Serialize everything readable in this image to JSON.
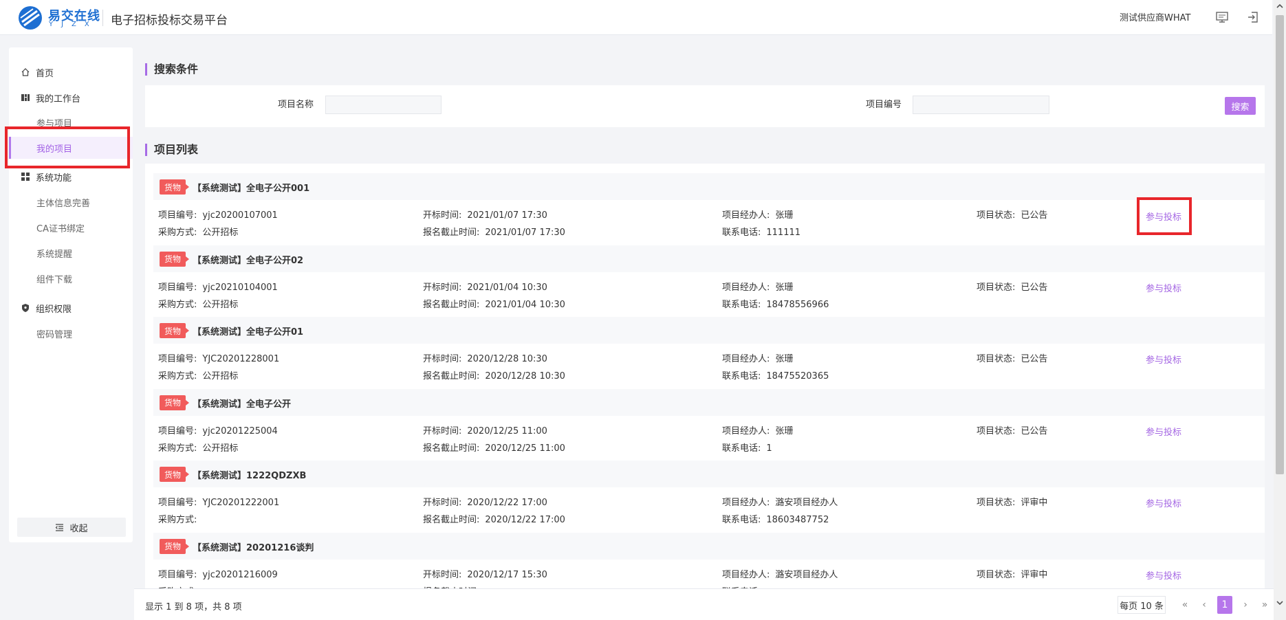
{
  "header": {
    "logo_text": "易交在线",
    "logo_sub": "YJZX",
    "title": "电子招标投标交易平台",
    "user": "测试供应商WHAT",
    "icons": [
      "monitor-icon",
      "logout-icon"
    ]
  },
  "sidebar": {
    "home": "首页",
    "workbench": "我的工作台",
    "join_project": "参与项目",
    "my_project": "我的项目",
    "system": "系统功能",
    "subject_info": "主体信息完善",
    "ca_bind": "CA证书绑定",
    "reminder": "系统提醒",
    "component_dl": "组件下载",
    "org_perm": "组织权限",
    "password": "密码管理",
    "collapse": "收起"
  },
  "search": {
    "section_title": "搜索条件",
    "name_label": "项目名称",
    "code_label": "项目编号",
    "button": "搜索"
  },
  "list": {
    "section_title": "项目列表",
    "labels": {
      "code": "项目编号:",
      "open_time": "开标时间:",
      "manager": "项目经办人:",
      "status": "项目状态:",
      "method": "采购方式:",
      "deadline": "报名截止时间:",
      "phone": "联系电话:"
    },
    "action": "参与投标",
    "items": [
      {
        "badge": "货物",
        "title": "【系统测试】全电子公开001",
        "code": "yjc20200107001",
        "open_time": "2021/01/07 17:30",
        "manager": "张珊",
        "status": "已公告",
        "method": "公开招标",
        "deadline": "2021/01/07 17:30",
        "phone": "111111"
      },
      {
        "badge": "货物",
        "title": "【系统测试】全电子公开02",
        "code": "yjc20210104001",
        "open_time": "2021/01/04 10:30",
        "manager": "张珊",
        "status": "已公告",
        "method": "公开招标",
        "deadline": "2021/01/04 10:30",
        "phone": "18478556966"
      },
      {
        "badge": "货物",
        "title": "【系统测试】全电子公开01",
        "code": "YJC20201228001",
        "open_time": "2020/12/28 10:30",
        "manager": "张珊",
        "status": "已公告",
        "method": "公开招标",
        "deadline": "2020/12/28 10:30",
        "phone": "18475520365"
      },
      {
        "badge": "货物",
        "title": "【系统测试】全电子公开",
        "code": "yjc20201225004",
        "open_time": "2020/12/25 11:00",
        "manager": "张珊",
        "status": "已公告",
        "method": "公开招标",
        "deadline": "2020/12/25 11:00",
        "phone": "1"
      },
      {
        "badge": "货物",
        "title": "【系统测试】1222QDZXB",
        "code": "YJC20201222001",
        "open_time": "2020/12/22 17:00",
        "manager": "潞安项目经办人",
        "status": "评审中",
        "method": "",
        "deadline": "2020/12/22 17:00",
        "phone": "18603487752"
      },
      {
        "badge": "货物",
        "title": "【系统测试】20201216谈判",
        "code": "yjc20201216009",
        "open_time": "2020/12/17 15:30",
        "manager": "潞安项目经办人",
        "status": "评审中",
        "method": "",
        "deadline": "",
        "phone": ""
      }
    ]
  },
  "footer": {
    "info": "显示 1 到 8 项，共 8 项",
    "per_page": "每页 10 条",
    "current_page": "1"
  },
  "colors": {
    "accent": "#b676eb",
    "badge": "#f15b5b",
    "highlight": "#e8262b"
  }
}
